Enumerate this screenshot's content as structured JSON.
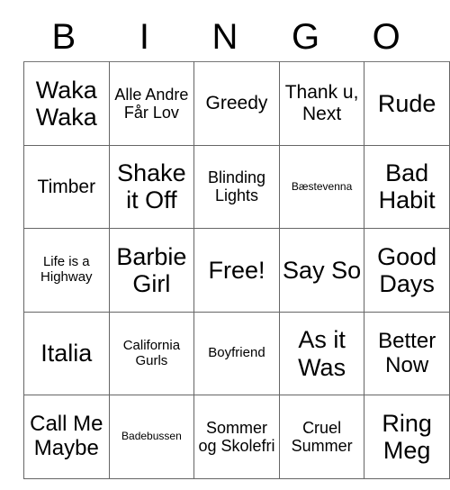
{
  "card": {
    "title": "BINGO",
    "header_letters": [
      "B",
      "I",
      "N",
      "G",
      "O"
    ],
    "free_space_label": "Free!",
    "rows": [
      [
        {
          "text": "Waka Waka",
          "size": "fs-xxl"
        },
        {
          "text": "Alle Andre Får Lov",
          "size": "fs-md"
        },
        {
          "text": "Greedy",
          "size": "fs-lg"
        },
        {
          "text": "Thank u, Next",
          "size": "fs-lg"
        },
        {
          "text": "Rude",
          "size": "fs-xxl"
        }
      ],
      [
        {
          "text": "Timber",
          "size": "fs-lg"
        },
        {
          "text": "Shake it Off",
          "size": "fs-xxl"
        },
        {
          "text": "Blinding Lights",
          "size": "fs-md"
        },
        {
          "text": "Bæstevenna",
          "size": "fs-xs"
        },
        {
          "text": "Bad Habit",
          "size": "fs-xxl"
        }
      ],
      [
        {
          "text": "Life is a Highway",
          "size": "fs-sm"
        },
        {
          "text": "Barbie Girl",
          "size": "fs-xxl"
        },
        {
          "text": "Free!",
          "size": "fs-xxl"
        },
        {
          "text": "Say So",
          "size": "fs-xxl"
        },
        {
          "text": "Good Days",
          "size": "fs-xxl"
        }
      ],
      [
        {
          "text": "Italia",
          "size": "fs-xxl"
        },
        {
          "text": "California Gurls",
          "size": "fs-sm"
        },
        {
          "text": "Boyfriend",
          "size": "fs-sm"
        },
        {
          "text": "As it Was",
          "size": "fs-xxl"
        },
        {
          "text": "Better Now",
          "size": "fs-xl"
        }
      ],
      [
        {
          "text": "Call Me Maybe",
          "size": "fs-xl"
        },
        {
          "text": "Badebussen",
          "size": "fs-xs"
        },
        {
          "text": "Sommer og Skolefri",
          "size": "fs-md"
        },
        {
          "text": "Cruel Summer",
          "size": "fs-md"
        },
        {
          "text": "Ring Meg",
          "size": "fs-xxl"
        }
      ]
    ]
  },
  "colors": {
    "background": "#ffffff",
    "text": "#000000",
    "grid_border": "#666666"
  }
}
